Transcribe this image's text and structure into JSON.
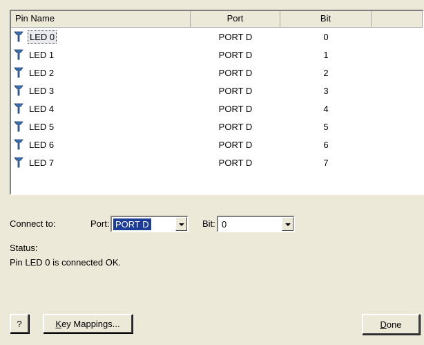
{
  "columns": {
    "pin_name": "Pin Name",
    "port": "Port",
    "bit": "Bit"
  },
  "rows": [
    {
      "pin": "LED 0",
      "port": "PORT D",
      "bit": "0"
    },
    {
      "pin": "LED 1",
      "port": "PORT D",
      "bit": "1"
    },
    {
      "pin": "LED 2",
      "port": "PORT D",
      "bit": "2"
    },
    {
      "pin": "LED 3",
      "port": "PORT D",
      "bit": "3"
    },
    {
      "pin": "LED 4",
      "port": "PORT D",
      "bit": "4"
    },
    {
      "pin": "LED 5",
      "port": "PORT D",
      "bit": "5"
    },
    {
      "pin": "LED 6",
      "port": "PORT D",
      "bit": "6"
    },
    {
      "pin": "LED 7",
      "port": "PORT D",
      "bit": "7"
    }
  ],
  "connect": {
    "label": "Connect to:",
    "port_label": "Port:",
    "port_value": "PORT D",
    "bit_label": "Bit:",
    "bit_value": "0"
  },
  "status": {
    "label": "Status:",
    "message": "Pin LED 0 is connected OK."
  },
  "buttons": {
    "help": "?",
    "key_mappings_u": "K",
    "key_mappings_rest": "ey Mappings...",
    "done_u": "D",
    "done_rest": "one"
  },
  "icons": {
    "pin": "pin-icon",
    "dropdown": "chevron-down-icon"
  },
  "colors": {
    "selection": "#1c3c96",
    "window": "#ece9d8",
    "icon": "#3a6fb0"
  }
}
